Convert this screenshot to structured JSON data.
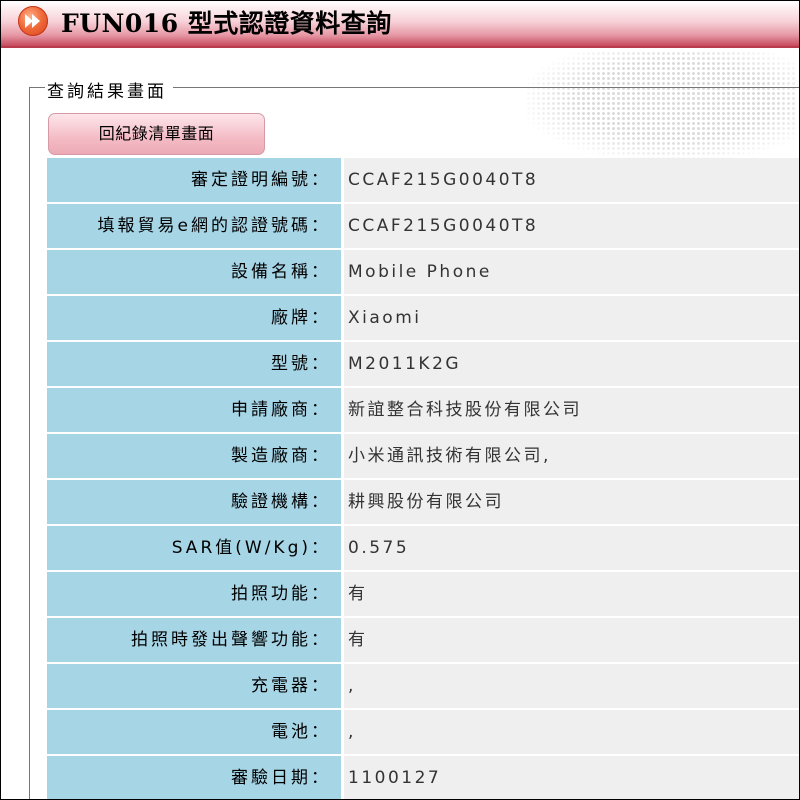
{
  "header": {
    "title": "FUN016 型式認證資料查詢",
    "icon": "fast-forward-icon"
  },
  "fieldset": {
    "legend": "查詢結果畫面"
  },
  "back_button": {
    "label": "回紀錄清單畫面"
  },
  "colors": {
    "label_bg": "#a6d5e6",
    "value_bg": "#efefef",
    "header_accent": "#c64a5d",
    "button_bg": "#f4bcc6"
  },
  "rows": [
    {
      "label": "審定證明編號：",
      "value": "CCAF215G0040T8"
    },
    {
      "label": "填報貿易e網的認證號碼：",
      "value": "CCAF215G0040T8"
    },
    {
      "label": "設備名稱：",
      "value": "Mobile Phone"
    },
    {
      "label": "廠牌：",
      "value": "Xiaomi"
    },
    {
      "label": "型號：",
      "value": "M2011K2G"
    },
    {
      "label": "申請廠商：",
      "value": "新誼整合科技股份有限公司"
    },
    {
      "label": "製造廠商：",
      "value": "小米通訊技術有限公司,"
    },
    {
      "label": "驗證機構：",
      "value": "耕興股份有限公司"
    },
    {
      "label": "SAR值(W/Kg)：",
      "value": "0.575"
    },
    {
      "label": "拍照功能：",
      "value": "有"
    },
    {
      "label": "拍照時發出聲響功能：",
      "value": "有"
    },
    {
      "label": "充電器：",
      "value": ","
    },
    {
      "label": "電池：",
      "value": ","
    },
    {
      "label": "審驗日期：",
      "value": "1100127"
    }
  ]
}
